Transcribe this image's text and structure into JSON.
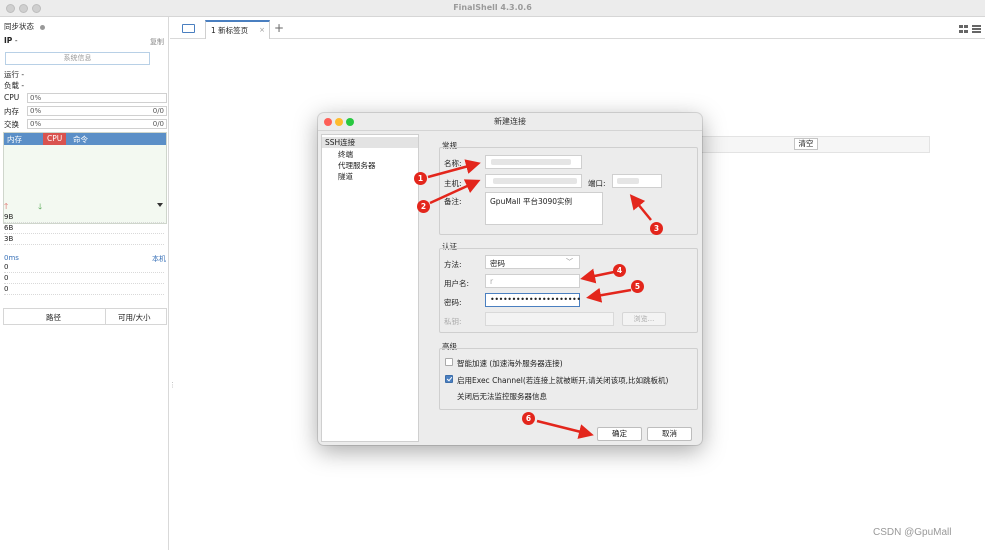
{
  "app": {
    "title": "FinalShell 4.3.0.6"
  },
  "sidebar": {
    "sync_status": "同步状态",
    "ip_label": "IP",
    "ip_value": "-",
    "copy_label": "复制",
    "sysinfo_button": "系统信息",
    "run_label": "运行",
    "run_value": "-",
    "load_label": "负载",
    "load_value": "-",
    "cpu_label": "CPU",
    "cpu_value": "0%",
    "mem_label": "内存",
    "mem_value": "0%",
    "mem_extra": "0/0",
    "swap_label": "交换",
    "swap_value": "0%",
    "swap_extra": "0/0",
    "process_tabs": {
      "mem": "内存",
      "cpu": "CPU",
      "cmd": "命令"
    },
    "net_scale": [
      "9B",
      "6B",
      "3B"
    ],
    "latency_label": "0ms",
    "local_label": "本机",
    "latency_scale": [
      "0",
      "0",
      "0"
    ],
    "fs_path": "路径",
    "fs_size": "可用/大小"
  },
  "tabs": [
    {
      "label": "1 新标签页",
      "close": "×"
    }
  ],
  "tab_add": "+",
  "background": {
    "clear_button": "清空"
  },
  "dialog": {
    "title": "新建连接",
    "tree": {
      "root": "SSH连接",
      "items": [
        "终端",
        "代理服务器",
        "隧道"
      ]
    },
    "general": {
      "legend": "常规",
      "name_label": "名称:",
      "host_label": "主机:",
      "port_label": "端口:",
      "note_label": "备注:",
      "note_value": "GpuMall 平台3090实例"
    },
    "auth": {
      "legend": "认证",
      "method_label": "方法:",
      "method_value": "密码",
      "user_label": "用户名:",
      "user_value": "r",
      "password_label": "密码:",
      "password_value": "•••••••••••••••••••••",
      "key_label": "私钥:",
      "browse_button": "浏览..."
    },
    "advanced": {
      "legend": "高级",
      "accel_label": "智能加速 (加速海外服务器连接)",
      "accel_checked": false,
      "exec_label": "启用Exec Channel(若连接上就被断开,请关闭该项,比如跳板机)",
      "exec_checked": true,
      "exec_note": "关闭后无法监控服务器信息"
    },
    "ok_button": "确定",
    "cancel_button": "取消"
  },
  "annotations": [
    "1",
    "2",
    "3",
    "4",
    "5",
    "6"
  ],
  "watermark": "CSDN @GpuMall",
  "colors": {
    "accent": "#4a7fc0",
    "annotation": "#e3261c",
    "cpu_tab": "#d9534f",
    "process_header": "#5b8fc7"
  }
}
